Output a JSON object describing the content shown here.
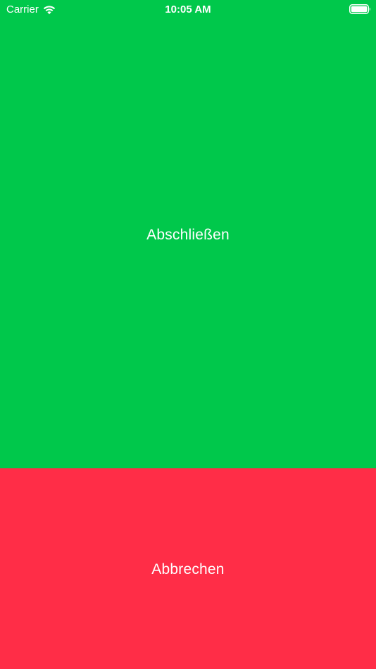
{
  "status_bar": {
    "carrier": "Carrier",
    "time": "10:05 AM",
    "wifi_icon": "wifi-icon",
    "battery_icon": "battery-icon"
  },
  "actions": {
    "complete_label": "Abschließen",
    "cancel_label": "Abbrechen"
  },
  "colors": {
    "complete_bg": "#00C84B",
    "cancel_bg": "#FF2D47",
    "text": "#FFFFFF"
  }
}
